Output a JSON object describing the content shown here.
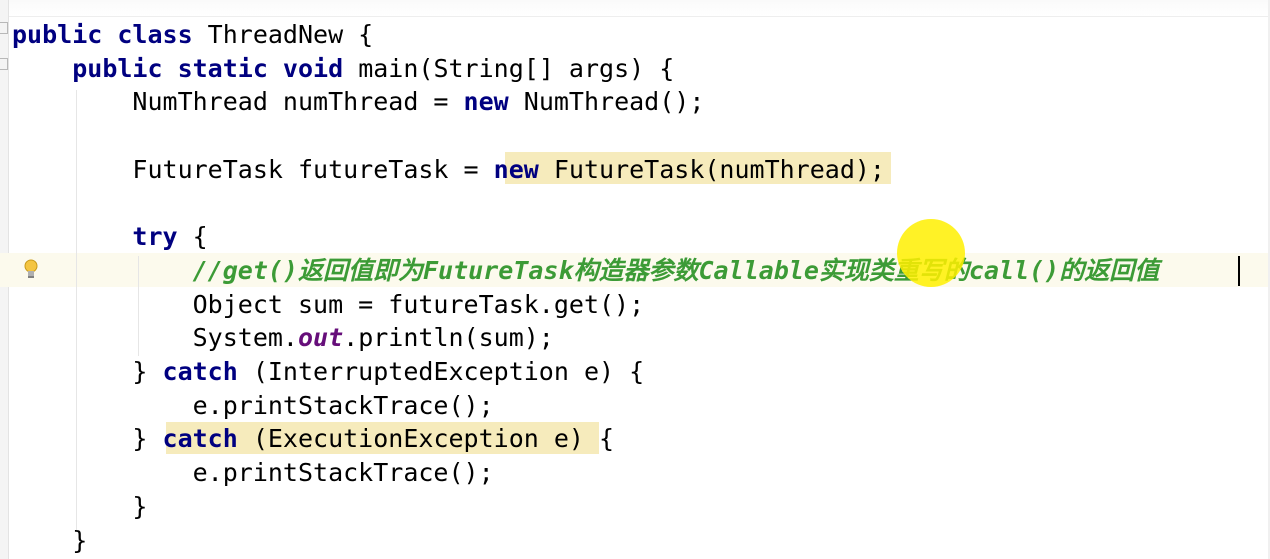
{
  "editor": {
    "language": "java",
    "lines": [
      {
        "id": "l1",
        "segments": [
          {
            "t": "public class ",
            "c": "kw"
          },
          {
            "t": "ThreadNew {",
            "c": "punc"
          }
        ]
      },
      {
        "id": "l2",
        "segments": [
          {
            "t": "    "
          },
          {
            "t": "public static void ",
            "c": "kw"
          },
          {
            "t": "main(String[] args) {",
            "c": "punc"
          }
        ]
      },
      {
        "id": "l3",
        "segments": [
          {
            "t": "        NumThread numThread = "
          },
          {
            "t": "new ",
            "c": "kw"
          },
          {
            "t": "NumThread();"
          }
        ]
      },
      {
        "id": "l4",
        "segments": []
      },
      {
        "id": "l5",
        "segments": [
          {
            "t": "        FutureTask futureTask = "
          },
          {
            "t": "new ",
            "c": "kw"
          },
          {
            "t": "FutureTask(numThread);"
          }
        ]
      },
      {
        "id": "l6",
        "segments": []
      },
      {
        "id": "l7",
        "segments": [
          {
            "t": "        "
          },
          {
            "t": "try ",
            "c": "kw"
          },
          {
            "t": "{"
          }
        ]
      },
      {
        "id": "l8",
        "segments": [
          {
            "t": "            "
          },
          {
            "t": "//get()返回值即为FutureTask构造器参数Callable实现类重写的call()的返回值",
            "c": "cmt"
          }
        ]
      },
      {
        "id": "l9",
        "segments": [
          {
            "t": "            Object sum = futureTask.get();"
          }
        ]
      },
      {
        "id": "l10",
        "segments": [
          {
            "t": "            System."
          },
          {
            "t": "out",
            "c": "fld"
          },
          {
            "t": ".println(sum);"
          }
        ]
      },
      {
        "id": "l11",
        "segments": [
          {
            "t": "        } "
          },
          {
            "t": "catch ",
            "c": "kw"
          },
          {
            "t": "(InterruptedException e) {"
          }
        ]
      },
      {
        "id": "l12",
        "segments": [
          {
            "t": "            e.printStackTrace();"
          }
        ]
      },
      {
        "id": "l13",
        "segments": [
          {
            "t": "        } "
          },
          {
            "t": "catch ",
            "c": "kw"
          },
          {
            "t": "(ExecutionException e) {"
          }
        ]
      },
      {
        "id": "l14",
        "segments": [
          {
            "t": "            e.printStackTrace();"
          }
        ]
      },
      {
        "id": "l15",
        "segments": [
          {
            "t": "        }"
          }
        ]
      },
      {
        "id": "l16",
        "segments": [
          {
            "t": "    }"
          }
        ]
      }
    ]
  },
  "colors": {
    "keyword": "#000080",
    "comment": "#3c9b36",
    "static_field": "#660e7a",
    "highlight": "#f6ebbc",
    "caret_row": "#fcfaed",
    "cursor_dot": "#fff000"
  },
  "icons": {
    "gutter_hint": "lightbulb-icon"
  }
}
